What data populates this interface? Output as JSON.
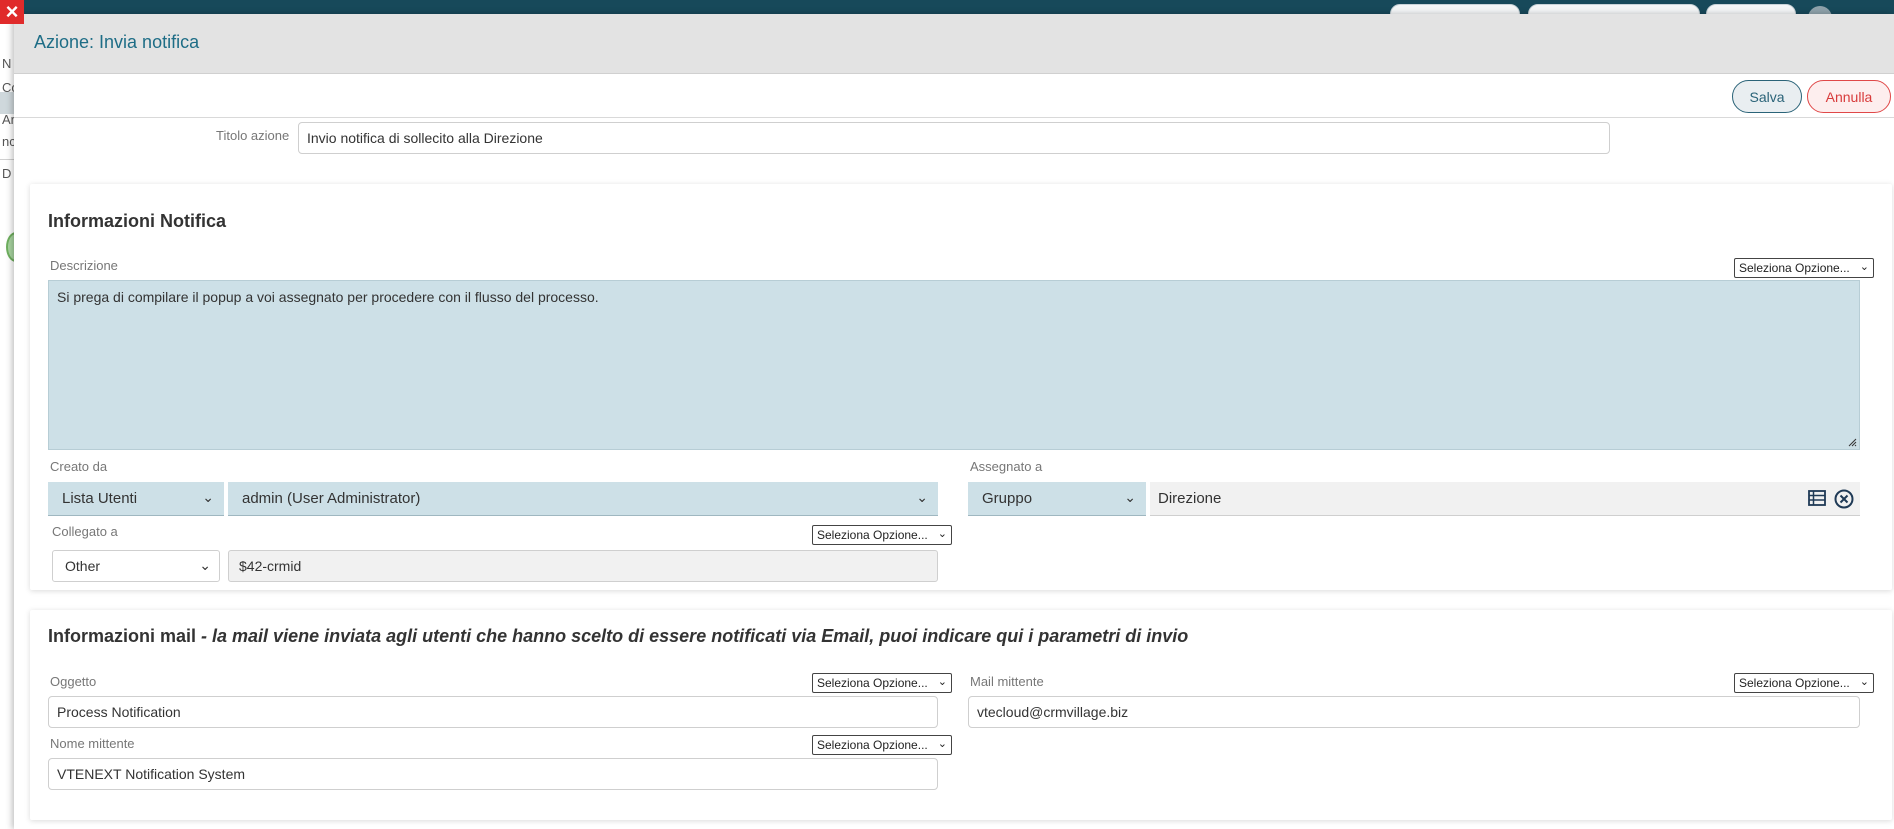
{
  "modal": {
    "title": "Azione: Invia notifica",
    "save_label": "Salva",
    "cancel_label": "Annulla"
  },
  "background": {
    "left_labels": [
      "N",
      "Co",
      "Ar",
      "nc",
      "D"
    ]
  },
  "action": {
    "title_label": "Titolo azione",
    "title_value": "Invio notifica di sollecito alla Direzione"
  },
  "notification": {
    "section_title": "Informazioni Notifica",
    "description_label": "Descrizione",
    "description_value": "Si prega di compilare il popup a voi assegnato per procedere con il flusso del processo.",
    "select_option_label": "Seleziona Opzione...",
    "created_by_label": "Creato da",
    "created_by_type": "Lista Utenti",
    "created_by_user": "admin (User Administrator)",
    "assigned_to_label": "Assegnato a",
    "assigned_to_type": "Gruppo",
    "assigned_to_value": "Direzione",
    "linked_to_label": "Collegato a",
    "linked_to_type": "Other",
    "linked_to_value": "$42-crmid"
  },
  "mail": {
    "section_title": "Informazioni mail",
    "section_subtitle": " - la mail viene inviata agli utenti che hanno scelto di essere notificati via Email, puoi indicare qui i parametri di invio",
    "subject_label": "Oggetto",
    "subject_value": "Process Notification",
    "sender_mail_label": "Mail mittente",
    "sender_mail_value": "vtecloud@crmvillage.biz",
    "sender_name_label": "Nome mittente",
    "sender_name_value": "VTENEXT Notification System",
    "select_option_label": "Seleziona Opzione..."
  },
  "icons": {
    "close": "close-icon",
    "list": "list-icon",
    "clear": "clear-circle-icon",
    "chevron": "chevron-down-icon"
  },
  "colors": {
    "title_accent": "#1e6d86",
    "save_border": "#2a6378",
    "cancel_border": "#e04848",
    "field_blue": "#cde0e7",
    "close_red": "#e02b2b"
  }
}
